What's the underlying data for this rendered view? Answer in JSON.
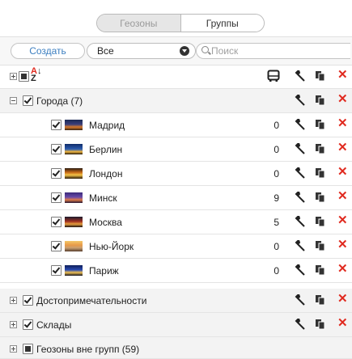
{
  "tabs": {
    "geozones": "Геозоны",
    "groups": "Группы"
  },
  "toolbar": {
    "create_label": "Создать",
    "filter_value": "Все",
    "search_placeholder": "Поиск"
  },
  "header": {
    "sort_icon": "sort-az-icon",
    "vehicle_icon": "bus-icon"
  },
  "groups": [
    {
      "name": "Города (7)",
      "checked": true,
      "expanded": true
    },
    {
      "name": "Достопримечательности",
      "checked": true,
      "expanded": false
    },
    {
      "name": "Склады",
      "checked": true,
      "expanded": false
    },
    {
      "name": "Геозоны вне групп (59)",
      "checked": false,
      "expanded": false
    }
  ],
  "cities": [
    {
      "name": "Мадрид",
      "count": "0"
    },
    {
      "name": "Берлин",
      "count": "0"
    },
    {
      "name": "Лондон",
      "count": "0"
    },
    {
      "name": "Минск",
      "count": "9"
    },
    {
      "name": "Москва",
      "count": "5"
    },
    {
      "name": "Нью-Йорк",
      "count": "0"
    },
    {
      "name": "Париж",
      "count": "0"
    }
  ],
  "colors": {
    "accent": "#3c7fc0",
    "delete": "#e02a1f"
  }
}
